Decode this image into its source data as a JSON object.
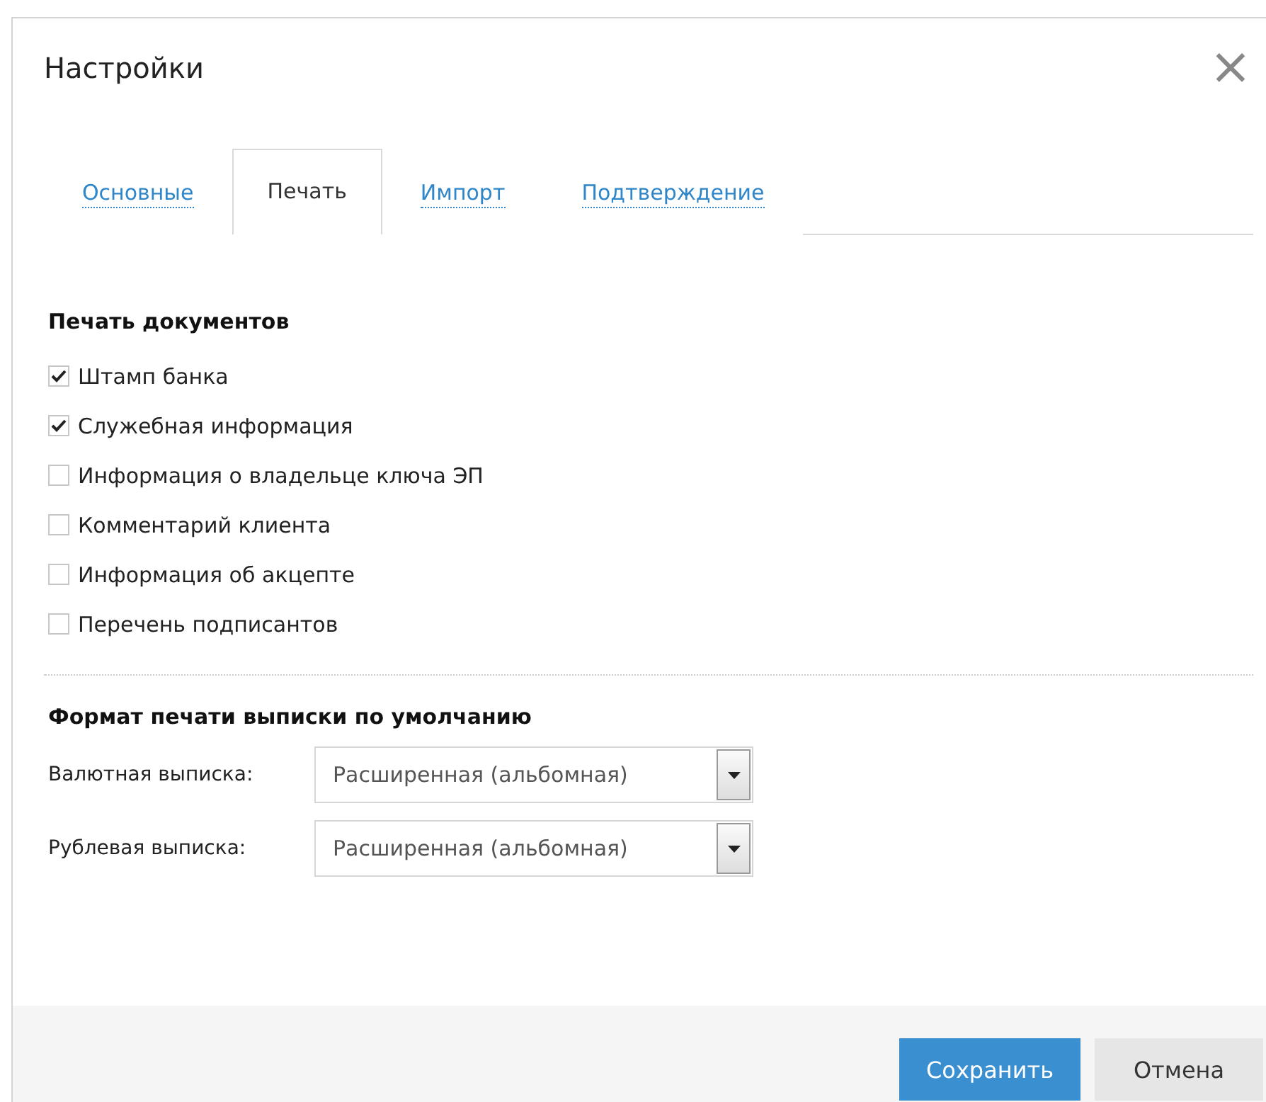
{
  "dialog": {
    "title": "Настройки",
    "close": "×"
  },
  "tabs": [
    {
      "label": "Основные",
      "selected": false
    },
    {
      "label": "Печать",
      "selected": true
    },
    {
      "label": "Импорт",
      "selected": false
    },
    {
      "label": "Подтверждение",
      "selected": false
    }
  ],
  "print_section": {
    "title": "Печать документов",
    "options": [
      {
        "label": "Штамп банка",
        "checked": true
      },
      {
        "label": "Служебная информация",
        "checked": true
      },
      {
        "label": "Информация о владельце ключа ЭП",
        "checked": false
      },
      {
        "label": "Комментарий клиента",
        "checked": false
      },
      {
        "label": "Информация об акцепте",
        "checked": false
      },
      {
        "label": "Перечень подписантов",
        "checked": false
      }
    ]
  },
  "format_section": {
    "title": "Формат печати выписки по умолчанию",
    "fields": [
      {
        "label": "Валютная выписка:",
        "value": "Расширенная (альбомная)"
      },
      {
        "label": "Рублевая выписка:",
        "value": "Расширенная (альбомная)"
      }
    ]
  },
  "buttons": [
    {
      "label": "Сохранить",
      "kind": "primary"
    },
    {
      "label": "Отмена",
      "kind": "secondary"
    }
  ]
}
